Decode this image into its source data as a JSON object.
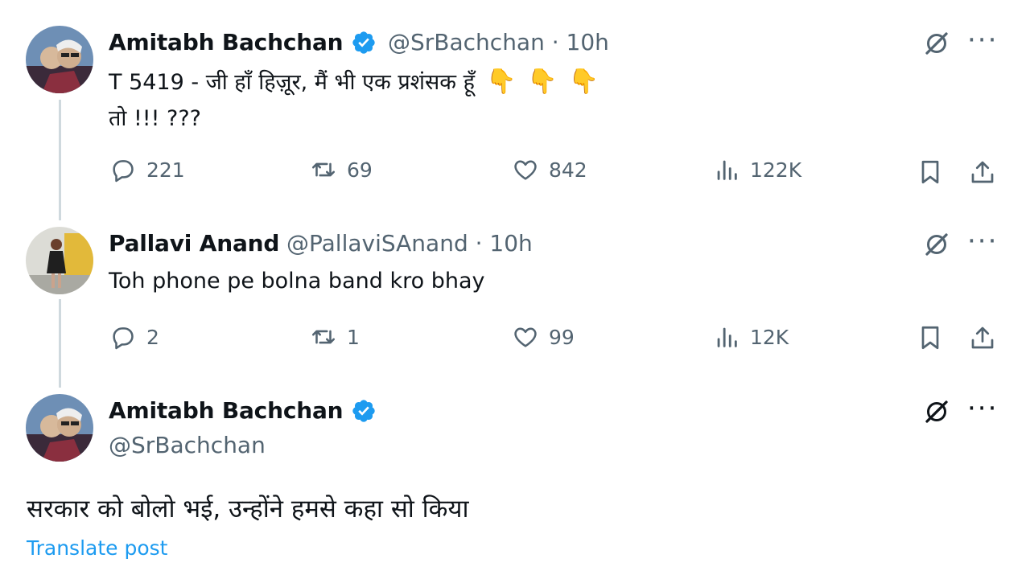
{
  "tweet1": {
    "name": "Amitabh Bachchan",
    "handle": "@SrBachchan · 10h",
    "text_line1": "T 5419 - जी हाँ हिज़ूर, मैं भी एक प्रशंसक हूँ",
    "text_line2": "तो !!! ???",
    "hands": [
      "👇",
      "👇",
      "👇"
    ],
    "replies": "221",
    "reposts": "69",
    "likes": "842",
    "views": "122K"
  },
  "tweet2": {
    "name": "Pallavi Anand",
    "handle": "@PallaviSAnand · 10h",
    "text": "Toh phone pe bolna band kro bhay",
    "replies": "2",
    "reposts": "1",
    "likes": "99",
    "views": "12K"
  },
  "tweet3": {
    "name": "Amitabh Bachchan",
    "handle": "@SrBachchan",
    "text": "सरकार को बोलो भई, उन्होंने हमसे कहा सो किया",
    "translate": "Translate post"
  },
  "icons": {
    "grok": "grok-icon",
    "more": "more-icon",
    "reply": "reply-icon",
    "repost": "repost-icon",
    "like": "like-icon",
    "views": "views-icon",
    "bookmark": "bookmark-icon",
    "share": "share-icon",
    "verified": "verified-badge-icon"
  },
  "colors": {
    "text": "#0f1419",
    "muted": "#536471",
    "accent": "#1d9bf0",
    "thread_line": "#cfd9de"
  },
  "more_glyph": "···"
}
